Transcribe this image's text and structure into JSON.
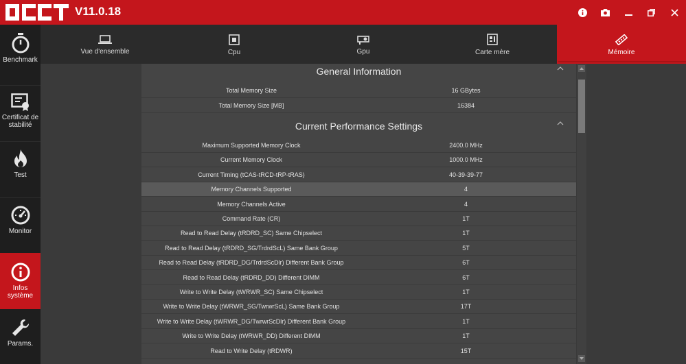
{
  "app": {
    "version": "V11.0.18",
    "accent": "#c4161c"
  },
  "titlebar": {
    "icons": [
      "info-icon",
      "camera-icon",
      "minimize-icon",
      "restore-icon",
      "close-icon"
    ]
  },
  "sidebar": {
    "items": [
      {
        "label": "Benchmark",
        "icon": "stopwatch-icon"
      },
      {
        "label": "Certificat de stabilité",
        "icon": "certificate-icon"
      },
      {
        "label": "Test",
        "icon": "flame-icon"
      },
      {
        "label": "Monitor",
        "icon": "gauge-icon"
      },
      {
        "label": "Infos système",
        "icon": "info-circle-icon",
        "active": true
      },
      {
        "label": "Params.",
        "icon": "wrench-icon"
      }
    ]
  },
  "tabs": [
    {
      "label": "Vue d'ensemble",
      "icon": "laptop-icon"
    },
    {
      "label": "Cpu",
      "icon": "cpu-icon"
    },
    {
      "label": "Gpu",
      "icon": "gpu-icon"
    },
    {
      "label": "Carte mère",
      "icon": "motherboard-icon"
    },
    {
      "label": "Mémoire",
      "icon": "memory-icon",
      "active": true
    }
  ],
  "general": {
    "title": "General Information",
    "rows": [
      {
        "k": "Total Memory Size",
        "v": "16 GBytes"
      },
      {
        "k": "Total Memory Size [MB]",
        "v": "16384"
      }
    ]
  },
  "performance": {
    "title": "Current Performance Settings",
    "rows": [
      {
        "k": "Maximum Supported Memory Clock",
        "v": "2400.0 MHz"
      },
      {
        "k": "Current Memory Clock",
        "v": "1000.0 MHz"
      },
      {
        "k": "Current Timing (tCAS-tRCD-tRP-tRAS)",
        "v": "40-39-39-77"
      },
      {
        "k": "Memory Channels Supported",
        "v": "4",
        "highlight": true
      },
      {
        "k": "Memory Channels Active",
        "v": "4"
      },
      {
        "k": "Command Rate (CR)",
        "v": "1T"
      },
      {
        "k": "Read to Read Delay (tRDRD_SC) Same Chipselect",
        "v": "1T"
      },
      {
        "k": "Read to Read Delay (tRDRD_SG/TrdrdScL) Same Bank Group",
        "v": "5T"
      },
      {
        "k": "Read to Read Delay (tRDRD_DG/TrdrdScDlr) Different Bank Group",
        "v": "6T"
      },
      {
        "k": "Read to Read Delay (tRDRD_DD) Different DIMM",
        "v": "6T"
      },
      {
        "k": "Write to Write Delay (tWRWR_SC) Same Chipselect",
        "v": "1T"
      },
      {
        "k": "Write to Write Delay (tWRWR_SG/TwrwrScL) Same Bank Group",
        "v": "17T"
      },
      {
        "k": "Write to Write Delay (tWRWR_DG/TwrwrScDlr) Different Bank Group",
        "v": "1T"
      },
      {
        "k": "Write to Write Delay (tWRWR_DD) Different DIMM",
        "v": "1T"
      },
      {
        "k": "Read to Write Delay (tRDWR)",
        "v": "15T"
      }
    ]
  }
}
